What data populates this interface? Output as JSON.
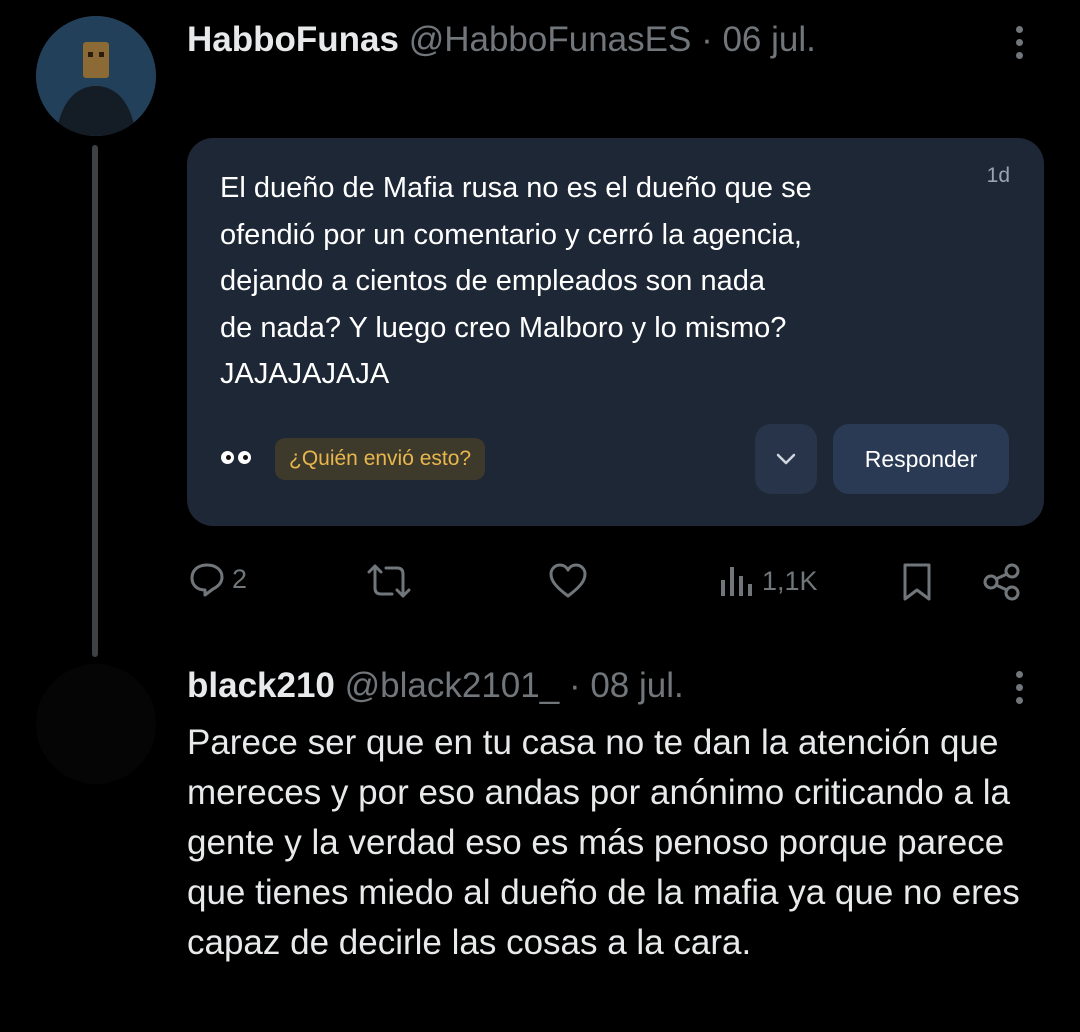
{
  "tweet": {
    "author_name": "HabboFunas",
    "author_handle": "@HabboFunasES",
    "separator": "·",
    "date": "06 jul.",
    "card": {
      "message": "El dueño de Mafia rusa no es el dueño que se\nofendió por un comentario y cerró la agencia,\ndejando a cientos de empleados son nada\nde nada? Y luego creo Malboro y lo mismo?\nJAJAJAJAJA",
      "age": "1d",
      "who_sent_label": "¿Quién envió esto?",
      "reply_button": "Responder"
    },
    "actions": {
      "replies": "2",
      "retweets": "",
      "likes": "",
      "views": "1,1K"
    }
  },
  "reply": {
    "author_name": "black210",
    "author_handle": "@black2101_",
    "separator": "·",
    "date": "08 jul.",
    "text": "Parece ser que en tu casa no te dan la atención que mereces y por eso andas por anónimo criticando a la gente y la verdad eso es más penoso porque parece que tienes miedo al dueño de la mafia ya que no eres capaz de decirle las cosas a la cara."
  },
  "icons": {
    "reply": "speech-bubble-icon",
    "retweet": "retweet-icon",
    "like": "heart-icon",
    "views": "bar-chart-icon",
    "bookmark": "bookmark-icon",
    "share": "share-icon",
    "more": "more-vertical-icon"
  },
  "colors": {
    "background": "#000000",
    "card": "#1e2735",
    "muted": "#71767b",
    "chip_text": "#e9b64d"
  }
}
